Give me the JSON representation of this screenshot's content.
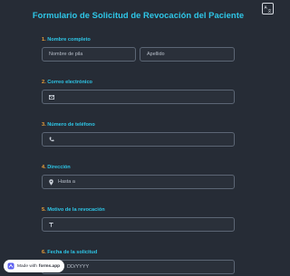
{
  "form": {
    "title": "Formulario de Solicitud de Revocación del Paciente"
  },
  "questions": [
    {
      "num": "1.",
      "label": "Nombre completo"
    },
    {
      "num": "2.",
      "label": "Correo electrónico"
    },
    {
      "num": "3.",
      "label": "Número de teléfono"
    },
    {
      "num": "4.",
      "label": "Dirección"
    },
    {
      "num": "5.",
      "label": "Motivo de la revocación"
    },
    {
      "num": "6.",
      "label": "Fecha de la solicitud"
    }
  ],
  "fields": {
    "first_name_placeholder": "Nombre de pila",
    "last_name_placeholder": "Apellido",
    "email_placeholder": "",
    "phone_placeholder": "",
    "address_placeholder": "Hasta a",
    "reason_placeholder": "",
    "date_placeholder": "DD/YYYY"
  },
  "badge": {
    "prefix": "Made with",
    "brand": "forms.app"
  },
  "colors": {
    "background": "#262c36",
    "accent": "#2ec7e8",
    "number": "#f0a33a",
    "field_border": "#5c6675"
  }
}
